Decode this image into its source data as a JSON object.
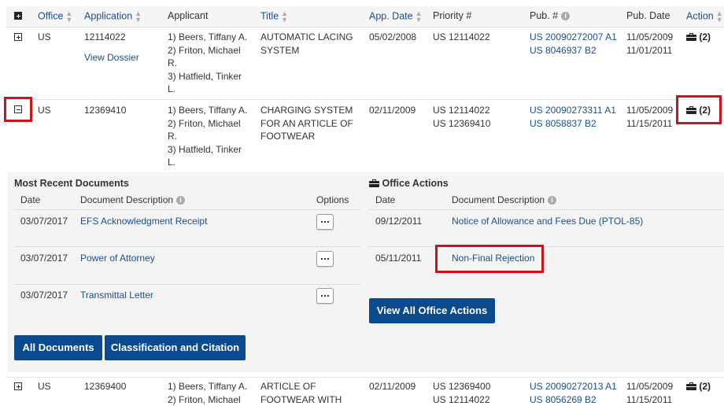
{
  "header": {
    "office": "Office",
    "application": "Application",
    "applicant": "Applicant",
    "title": "Title",
    "app_date": "App. Date",
    "priority": "Priority #",
    "pub_num": "Pub. #",
    "pub_date": "Pub. Date",
    "action": "Action"
  },
  "rows": [
    {
      "office": "US",
      "application": "12114022",
      "view_dossier": "View Dossier",
      "applicants": [
        "1) Beers, Tiffany A.",
        "2) Friton, Michael",
        "R.",
        "3) Hatfield, Tinker",
        "L."
      ],
      "title": [
        "AUTOMATIC LACING",
        "SYSTEM"
      ],
      "app_date": "05/02/2008",
      "priority": [
        "US 12114022"
      ],
      "pubs": [
        "US 20090272007 A1",
        "US 8046937 B2"
      ],
      "pub_dates": [
        "11/05/2009",
        "11/01/2011"
      ],
      "action": "(2)"
    },
    {
      "office": "US",
      "application": "12369410",
      "applicants": [
        "1) Beers, Tiffany A.",
        "2) Friton, Michael",
        "R.",
        "3) Hatfield, Tinker",
        "L."
      ],
      "title": [
        "CHARGING SYSTEM",
        "FOR AN ARTICLE OF",
        "FOOTWEAR"
      ],
      "app_date": "02/11/2009",
      "priority": [
        "US 12114022",
        "US 12369410"
      ],
      "pubs": [
        "US 20090273311 A1",
        "US 8058837 B2"
      ],
      "pub_dates": [
        "11/05/2009",
        "11/15/2011"
      ],
      "action": "(2)"
    },
    {
      "office": "US",
      "application": "12369400",
      "applicants": [
        "1) Beers, Tiffany A.",
        "2) Friton, Michael"
      ],
      "title": [
        "ARTICLE OF",
        "FOOTWEAR WITH"
      ],
      "app_date": "02/11/2009",
      "priority": [
        "US 12369400",
        "US 12114022"
      ],
      "pubs": [
        "US 20090272013 A1",
        "US 8056269 B2"
      ],
      "pub_dates": [
        "11/05/2009",
        "11/15/2011"
      ],
      "action": "(2)"
    }
  ],
  "recent_docs": {
    "heading": "Most Recent Documents",
    "col_date": "Date",
    "col_desc": "Document Description",
    "col_options": "Options",
    "items": [
      {
        "date": "03/07/2017",
        "desc": "EFS Acknowledgment Receipt"
      },
      {
        "date": "03/07/2017",
        "desc": "Power of Attorney"
      },
      {
        "date": "03/07/2017",
        "desc": "Transmittal Letter"
      }
    ],
    "btn_all": "All Documents",
    "btn_class": "Classification and Citation"
  },
  "office_actions": {
    "heading": "Office Actions",
    "col_date": "Date",
    "col_desc": "Document Description",
    "items": [
      {
        "date": "09/12/2011",
        "desc": "Notice of Allowance and Fees Due (PTOL-85)"
      },
      {
        "date": "05/11/2011",
        "desc": "Non-Final Rejection"
      }
    ],
    "btn_view_all": "View All Office Actions"
  },
  "colors": {
    "link": "#1a4f8b",
    "button": "#0c4a8f",
    "highlight": "#d0121b"
  }
}
